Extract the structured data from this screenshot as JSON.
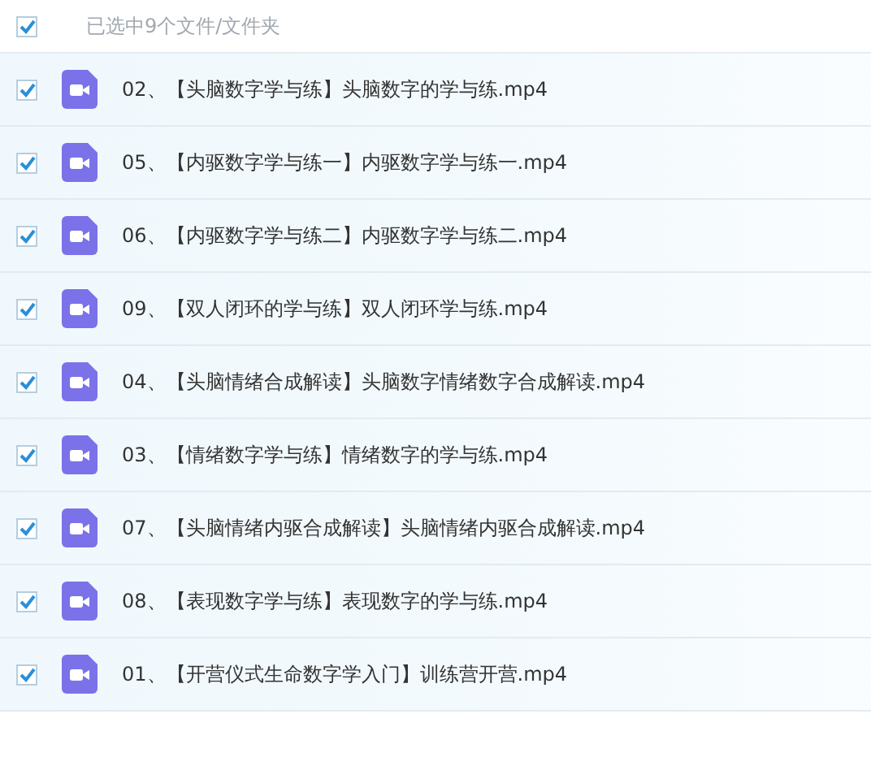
{
  "header": {
    "checked": true,
    "summary": "已选中9个文件/文件夹"
  },
  "files": [
    {
      "name": "02、【头脑数字学与练】头脑数字的学与练.mp4",
      "selected": true
    },
    {
      "name": "05、【内驱数字学与练一】内驱数字学与练一.mp4",
      "selected": true
    },
    {
      "name": "06、【内驱数字学与练二】内驱数字学与练二.mp4",
      "selected": true
    },
    {
      "name": "09、【双人闭环的学与练】双人闭环学与练.mp4",
      "selected": true
    },
    {
      "name": "04、【头脑情绪合成解读】头脑数字情绪数字合成解读.mp4",
      "selected": true
    },
    {
      "name": "03、【情绪数字学与练】情绪数字的学与练.mp4",
      "selected": true
    },
    {
      "name": "07、【头脑情绪内驱合成解读】头脑情绪内驱合成解读.mp4",
      "selected": true
    },
    {
      "name": "08、【表现数字学与练】表现数字的学与练.mp4",
      "selected": true
    },
    {
      "name": "01、【开营仪式生命数字学入门】训练营开营.mp4",
      "selected": true
    }
  ]
}
